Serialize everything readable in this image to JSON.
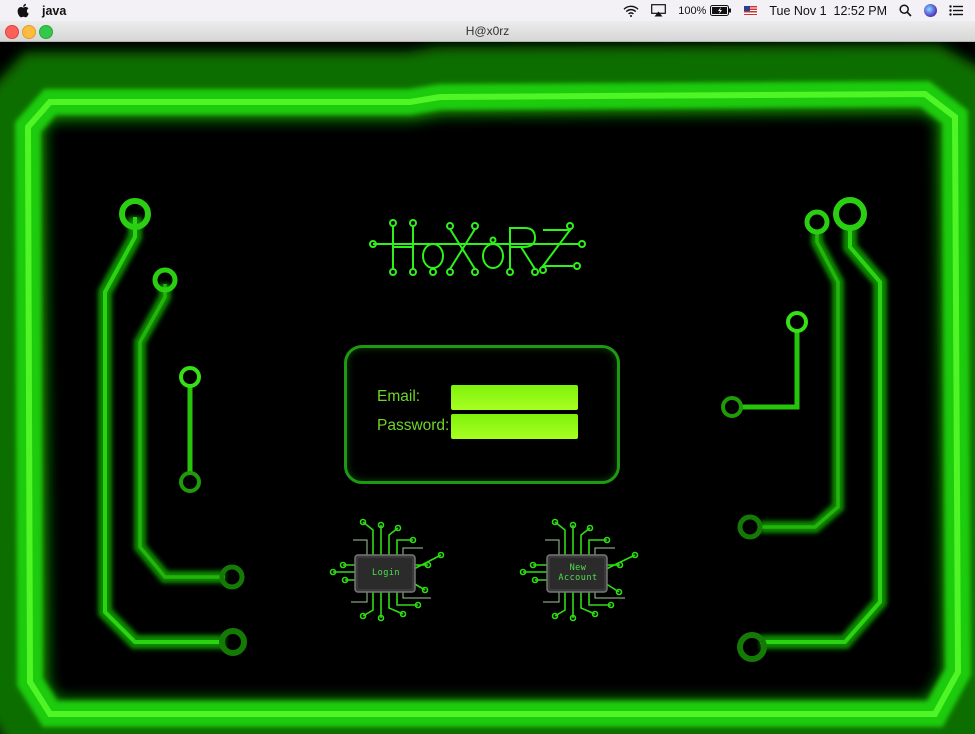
{
  "menubar": {
    "app_name": "java",
    "battery": "100%",
    "datetime": "Tue Nov 1  12:52 PM",
    "icons": [
      "apple-icon",
      "wifi-icon",
      "airplay-icon",
      "battery-icon",
      "flag-icon",
      "search-icon",
      "siri-icon",
      "menu-list-icon"
    ]
  },
  "window": {
    "title": "H@x0rz"
  },
  "game": {
    "logo_text": "HaXoRz",
    "email_label": "Email:",
    "password_label": "Password:",
    "email_value": "",
    "password_value": "",
    "login_button": "Login",
    "new_account_button_line1": "New",
    "new_account_button_line2": "Account"
  },
  "colors": {
    "neon_green": "#22ff00",
    "field_green": "#8ff514",
    "label_green": "#6fd627",
    "panel_border": "#1e9a12",
    "background": "#000000"
  }
}
